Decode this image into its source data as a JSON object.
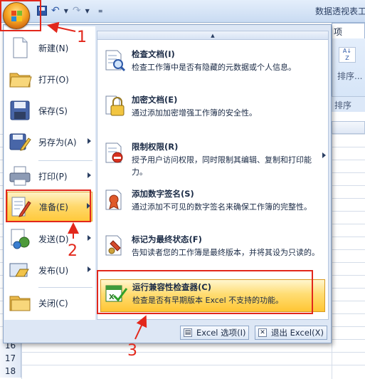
{
  "app": {
    "title": "数据透视表工",
    "ribbon_tab": "项",
    "sort_label": "排序...",
    "ribbon_group": "排序"
  },
  "sheet": {
    "rows": [
      "16",
      "17",
      "18"
    ]
  },
  "office_button": {
    "icon": "office-logo-icon"
  },
  "menu": {
    "left_items": [
      {
        "label": "新建(N)",
        "icon": "new-document-icon",
        "submenu": false
      },
      {
        "label": "打开(O)",
        "icon": "open-folder-icon",
        "submenu": false
      },
      {
        "label": "保存(S)",
        "icon": "save-disk-icon",
        "submenu": false
      },
      {
        "label": "另存为(A)",
        "icon": "save-as-icon",
        "submenu": true
      },
      {
        "label": "打印(P)",
        "icon": "printer-icon",
        "submenu": true
      },
      {
        "label": "准备(E)",
        "icon": "prepare-icon",
        "submenu": true
      },
      {
        "label": "发送(D)",
        "icon": "send-icon",
        "submenu": true
      },
      {
        "label": "发布(U)",
        "icon": "publish-icon",
        "submenu": true
      },
      {
        "label": "关闭(C)",
        "icon": "close-document-icon",
        "submenu": false
      }
    ],
    "right_items": [
      {
        "title": "检查文档(I)",
        "desc": "检查工作簿中是否有隐藏的元数据或个人信息。",
        "icon": "inspect-document-icon"
      },
      {
        "title": "加密文档(E)",
        "desc": "通过添加加密增强工作簿的安全性。",
        "icon": "encrypt-lock-icon"
      },
      {
        "title": "限制权限(R)",
        "desc": "授予用户访问权限，同时限制其编辑、复制和打印能力。",
        "icon": "restrict-permission-icon"
      },
      {
        "title": "添加数字签名(S)",
        "desc": "通过添加不可见的数字签名来确保工作簿的完整性。",
        "icon": "digital-signature-icon"
      },
      {
        "title": "标记为最终状态(F)",
        "desc": "告知读者您的工作簿是最终版本，并将其设为只读的。",
        "icon": "mark-final-icon"
      },
      {
        "title": "运行兼容性检查器(C)",
        "desc": "检查是否有早期版本 Excel 不支持的功能。",
        "icon": "compatibility-checker-icon"
      }
    ],
    "footer": {
      "options_label": "Excel 选项(I)",
      "exit_label": "退出 Excel(X)"
    }
  },
  "annotations": {
    "n1": "1",
    "n2": "2",
    "n3": "3"
  },
  "colors": {
    "highlight_red": "#e2271b",
    "active_yellow": "#ffd86a",
    "menu_border": "#8ea6c8"
  }
}
